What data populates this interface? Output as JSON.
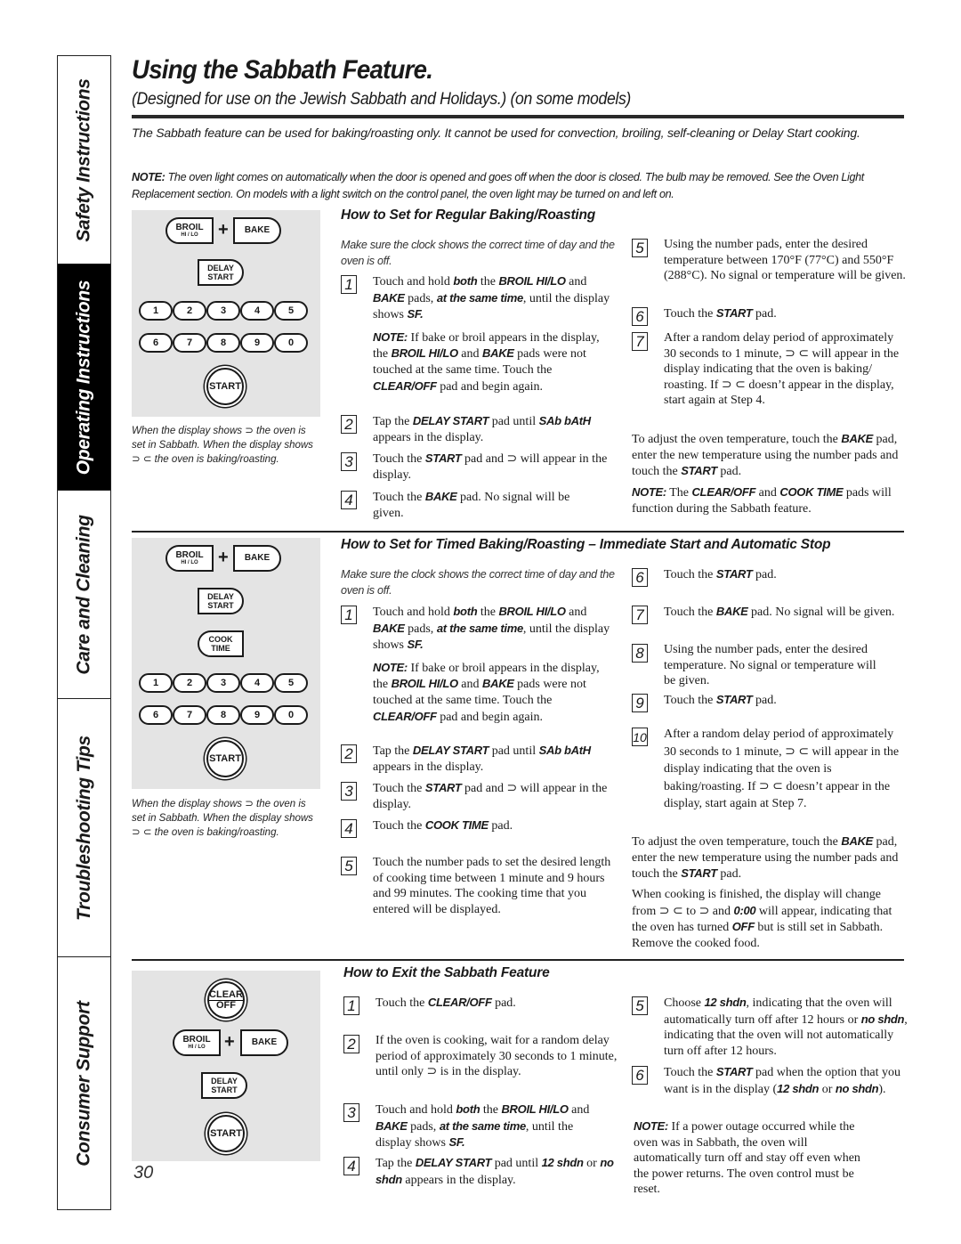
{
  "sidetabs": [
    {
      "label": "Safety Instructions",
      "active": false
    },
    {
      "label": "Operating Instructions",
      "active": true
    },
    {
      "label": "Care and Cleaning",
      "active": false
    },
    {
      "label": "Troubleshooting Tips",
      "active": false
    },
    {
      "label": "Consumer Support",
      "active": false
    }
  ],
  "header": {
    "title": "Using the Sabbath Feature.",
    "subtitle": "(Designed for use on the Jewish Sabbath and Holidays.) (on some models)",
    "intro": "The Sabbath feature can be used for baking/roasting only. It cannot be used for convection, broiling, self-cleaning or Delay Start cooking.",
    "note_label": "NOTE:",
    "note": " The oven light comes on automatically when the door is opened and goes off when the door is closed. The bulb may be removed. See the Oven Light Replacement section. On models with a light switch on the control panel, the oven light may be turned on and left on."
  },
  "keypad": {
    "broil": "BROIL",
    "broil_sub": "HI / LO",
    "plus": "+",
    "bake": "BAKE",
    "delay1": "DELAY",
    "delay2": "START",
    "cook1": "COOK",
    "cook2": "TIME",
    "clear1": "CLEAR",
    "clear2": "OFF",
    "start": "START",
    "numbers": [
      "1",
      "2",
      "3",
      "4",
      "5",
      "6",
      "7",
      "8",
      "9",
      "0"
    ]
  },
  "caption": "When the display shows ⊃ the oven is set in Sabbath. When the display shows ⊃ ⊂ the oven is baking/roasting.",
  "regular": {
    "heading": "How to Set for Regular Baking/Roasting",
    "lead": "Make sure the clock shows the correct time of day and the oven is off.",
    "steps": {
      "s1": {
        "n": "1",
        "t1": "Touch and hold ",
        "b1": "both",
        "t2": " the ",
        "b2": "BROIL HI/LO",
        "t3": " and ",
        "b3": "BAKE",
        "t4": " pads, ",
        "b4": "at the same time",
        "t5": ", until the display shows ",
        "b5": "SF."
      },
      "s1note": {
        "b1": "NOTE:",
        "t1": " If bake or broil appears in the display, the ",
        "b2": "BROIL HI/LO",
        "t2": " and ",
        "b3": "BAKE",
        "t3": " pads were not touched at the same time. Touch the ",
        "b4": "CLEAR/OFF",
        "t4": " pad and begin again."
      },
      "s2": {
        "n": "2",
        "t1": "Tap the ",
        "b1": "DELAY START",
        "t2": " pad until ",
        "b2": "SAb bAtH",
        "t3": " appears in the display."
      },
      "s3": {
        "n": "3",
        "t1": "Touch the ",
        "b1": "START",
        "t2": " pad and ⊃ will appear in the display."
      },
      "s4": {
        "n": "4",
        "t1": "Touch the ",
        "b1": "BAKE",
        "t2": " pad. No signal will be given."
      },
      "s5": {
        "n": "5",
        "t1": "Using the number pads, enter the desired temperature between 170°F (77°C) and 550°F (288°C). No signal or temperature will be given."
      },
      "s6": {
        "n": "6",
        "t1": "Touch the ",
        "b1": "START",
        "t2": " pad."
      },
      "s7": {
        "n": "7",
        "t1": "After a random delay period of approximately 30 seconds to 1 minute, ⊃ ⊂ will appear in the display indicating that the oven is baking/ roasting. If ⊃ ⊂ doesn’t appear in the display, start again at Step 4."
      }
    },
    "adjust": {
      "t1": "To adjust the oven temperature, touch the ",
      "b1": "BAKE",
      "t2": " pad, enter the new temperature using the number pads and touch the ",
      "b2": "START",
      "t3": " pad."
    },
    "note": {
      "b1": "NOTE:",
      "t1": " The ",
      "b2": "CLEAR/OFF",
      "t2": " and ",
      "b3": "COOK TIME",
      "t3": " pads will function during the Sabbath feature."
    }
  },
  "timed": {
    "heading": "How to Set for Timed Baking/Roasting – Immediate Start and Automatic Stop",
    "lead": "Make sure the clock shows the correct time of day and the oven is off.",
    "steps": {
      "s1": {
        "n": "1",
        "t1": "Touch and hold ",
        "b1": "both",
        "t2": " the ",
        "b2": "BROIL HI/LO",
        "t3": " and ",
        "b3": "BAKE",
        "t4": " pads, ",
        "b4": "at the same time",
        "t5": ", until the display shows ",
        "b5": "SF."
      },
      "s1note": {
        "b1": "NOTE:",
        "t1": " If bake or broil appears in the display, the ",
        "b2": "BROIL HI/LO",
        "t2": " and ",
        "b3": "BAKE",
        "t3": " pads were not touched at the same time. Touch the ",
        "b4": "CLEAR/OFF",
        "t4": " pad and begin again."
      },
      "s2": {
        "n": "2",
        "t1": "Tap the ",
        "b1": "DELAY START",
        "t2": " pad until ",
        "b2": "SAb bAtH",
        "t3": " appears in the display."
      },
      "s3": {
        "n": "3",
        "t1": "Touch the ",
        "b1": "START",
        "t2": " pad and ⊃ will appear in the display."
      },
      "s4": {
        "n": "4",
        "t1": "Touch the ",
        "b1": "COOK TIME",
        "t2": " pad."
      },
      "s5": {
        "n": "5",
        "t1": "Touch the number pads to set the desired length of cooking time between 1 minute and 9 hours and 99 minutes. The cooking time that you entered will be displayed."
      },
      "s6": {
        "n": "6",
        "t1": "Touch the ",
        "b1": "START",
        "t2": " pad."
      },
      "s7": {
        "n": "7",
        "t1": "Touch the ",
        "b1": "BAKE",
        "t2": " pad. No signal will be given."
      },
      "s8": {
        "n": "8",
        "t1": "Using the number pads, enter the desired temperature. No signal or temperature will be given."
      },
      "s9": {
        "n": "9",
        "t1": "Touch the ",
        "b1": "START",
        "t2": " pad."
      },
      "s10": {
        "n": "10",
        "t1": "After a random delay period of approximately 30 seconds to 1 minute, ⊃ ⊂ will appear in the display indicating that the oven is baking/roasting. If ⊃ ⊂ doesn’t appear in the display, start again at Step 7."
      }
    },
    "adjust": {
      "t1": "To adjust the oven temperature, touch the ",
      "b1": "BAKE",
      "t2": " pad, enter the new temperature using the number pads and touch the ",
      "b2": "START",
      "t3": " pad."
    },
    "finished": {
      "t1": "When cooking is finished, the display will change from ⊃ ⊂ to ⊃ and ",
      "b1": "0:00",
      "t2": " will appear, indicating that the oven has turned ",
      "b2": "OFF",
      "t3": " but is still set in Sabbath. Remove the cooked food."
    }
  },
  "exit": {
    "heading": "How to Exit the Sabbath Feature",
    "steps": {
      "s1": {
        "n": "1",
        "t1": "Touch the ",
        "b1": "CLEAR/OFF",
        "t2": " pad."
      },
      "s2": {
        "n": "2",
        "t1": "If the oven is cooking, wait for a random delay period of approximately 30 seconds to 1 minute, until only ⊃ is in the display."
      },
      "s3": {
        "n": "3",
        "t1": "Touch and hold ",
        "b1": "both",
        "t2": " the ",
        "b2": "BROIL HI/LO",
        "t3": " and ",
        "b3": "BAKE",
        "t4": " pads, ",
        "b4": "at the same time",
        "t5": ", until the display shows ",
        "b5": "SF."
      },
      "s4": {
        "n": "4",
        "t1": "Tap the ",
        "b1": "DELAY START",
        "t2": " pad until ",
        "b2": "12 shdn",
        "t3": " or ",
        "b3": "no shdn",
        "t4": " appears in the display."
      },
      "s5": {
        "n": "5",
        "t1": "Choose ",
        "b1": "12 shdn",
        "t2": ", indicating that the oven will automatically turn off after 12 hours or ",
        "b2": "no shdn",
        "t3": ", indicating that the oven will not automatically turn off after 12 hours."
      },
      "s6": {
        "n": "6",
        "t1": "Touch the ",
        "b1": "START",
        "t2": " pad when the option that you want is in the display (",
        "b2": "12 shdn",
        "t3": " or ",
        "b3": "no shdn",
        "t4": ")."
      }
    },
    "note": {
      "b1": "NOTE:",
      "t1": " If a power outage occurred while the oven was in Sabbath, the oven will automatically turn off and stay off even when the power returns. The oven control must be reset."
    }
  },
  "page_number": "30"
}
